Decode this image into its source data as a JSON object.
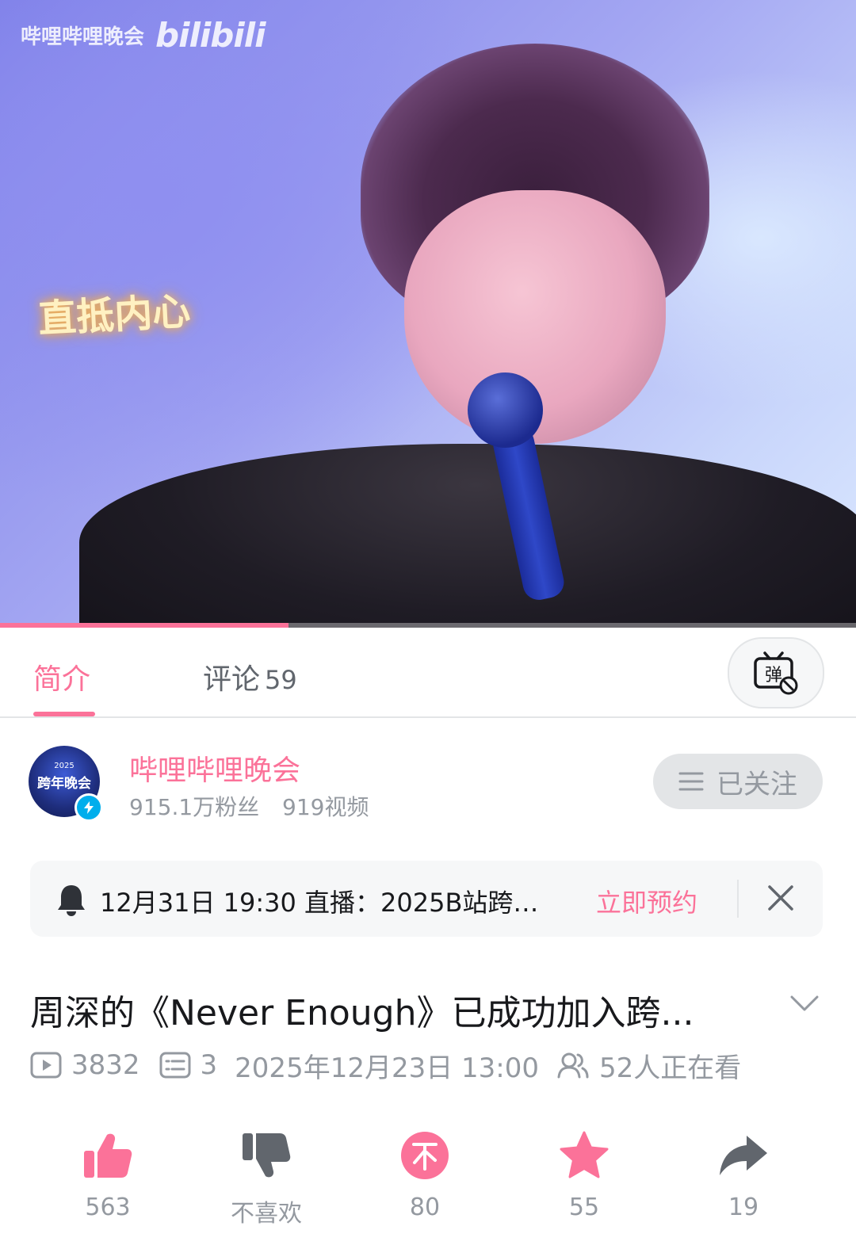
{
  "video": {
    "watermark_channel": "哔哩哔哩晚会",
    "watermark_logo": "bilibili",
    "overlay_caption": "直抵内心",
    "progress": 0.337
  },
  "tabs": {
    "intro": "简介",
    "comments": "评论",
    "comments_count": "59",
    "danmaku_icon": "danmaku-toggle-icon"
  },
  "uploader": {
    "name": "哔哩哔哩晚会",
    "fans": "915.1万粉丝",
    "videos": "919视频",
    "avatar_text_top": "2025",
    "avatar_text_mid": "跨年晚会",
    "follow_label": "已关注"
  },
  "reservation": {
    "text": "12月31日 19:30 直播：2025B站跨…",
    "action": "立即预约"
  },
  "video_info": {
    "title": "周深的《Never Enough》已成功加入跨...",
    "plays": "3832",
    "danmaku": "3",
    "date": "2025年12月23日 13:00",
    "watching": "52人正在看"
  },
  "actions": {
    "like": "563",
    "dislike": "不喜欢",
    "coin": "80",
    "favorite": "55",
    "share": "19"
  },
  "colors": {
    "accent": "#fb7299",
    "muted": "#9499a0",
    "text": "#18191c"
  }
}
